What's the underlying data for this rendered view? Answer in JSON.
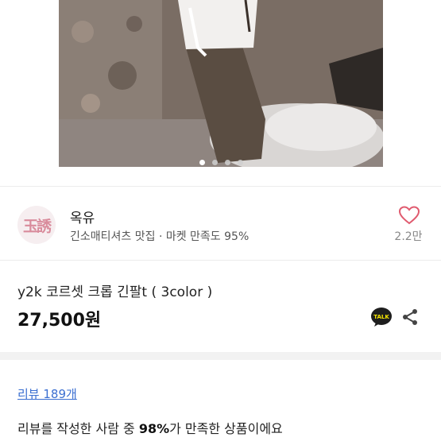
{
  "carousel": {
    "image_alt": "product photo",
    "pages": 4,
    "active_page": 1
  },
  "seller": {
    "avatar_text": "玉誘",
    "name": "옥유",
    "meta": "긴소매티셔츠 맛집 · 마켓 만족도 95%",
    "likes": "2.2만"
  },
  "product": {
    "title": "y2k 코르셋 크롭 긴팔t ( 3color )",
    "price": "27,500원",
    "talk_label": "TALK"
  },
  "reviews": {
    "link": "리뷰 189개",
    "summary_prefix": "리뷰를 작성한 사람 중 ",
    "summary_percent": "98%",
    "summary_suffix": "가 만족한 상품이에요"
  },
  "colors": {
    "heart": "#e05a6e",
    "link": "#3b6fd1"
  }
}
